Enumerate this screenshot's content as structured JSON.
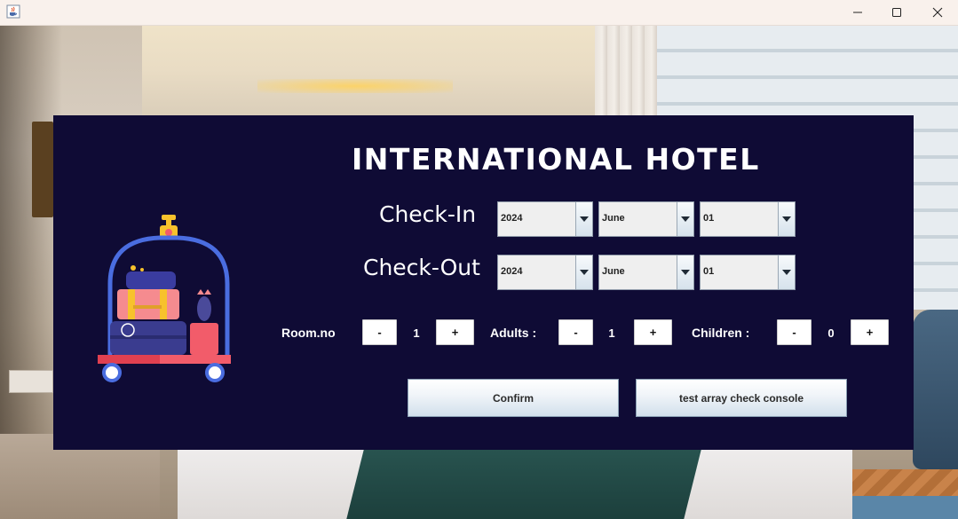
{
  "window": {
    "title": "",
    "icon": "java-cup-icon",
    "controls": [
      "minimize-icon",
      "maximize-icon",
      "close-icon"
    ]
  },
  "panel": {
    "title": "INTERNATIONAL HOTEL",
    "illustration": "luggage-cart-icon",
    "checkin": {
      "label": "Check-In",
      "year": "2024",
      "month": "June",
      "day": "01"
    },
    "checkout": {
      "label": "Check-Out",
      "year": "2024",
      "month": "June",
      "day": "01"
    },
    "room": {
      "label": "Room.no",
      "minus": "-",
      "value": "1",
      "plus": "+"
    },
    "adults": {
      "label": "Adults :",
      "minus": "-",
      "value": "1",
      "plus": "+"
    },
    "children": {
      "label": "Children :",
      "minus": "-",
      "value": "0",
      "plus": "+"
    },
    "buttons": {
      "confirm": "Confirm",
      "test": "test array check console"
    }
  },
  "colors": {
    "panel_bg": "#0f0b35",
    "cart_frame": "#4a6de0",
    "cart_base": "#f25c6a"
  }
}
